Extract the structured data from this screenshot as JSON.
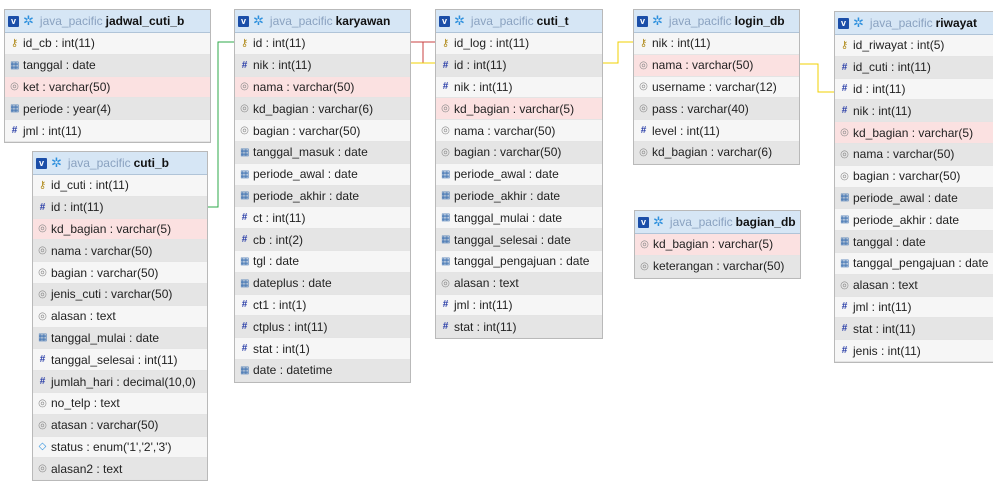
{
  "link_color": "#f0d000",
  "link_color_red": "#c94040",
  "link_color_green": "#2ea84a",
  "tables": [
    {
      "db": "java_pacific",
      "name": "jadwal_cuti_b",
      "cols": [
        {
          "t": "id_cb : int(11)",
          "k": "key"
        },
        {
          "t": "tanggal : date",
          "k": "date"
        },
        {
          "t": "ket : varchar(50)",
          "k": "str",
          "fk": true
        },
        {
          "t": "periode : year(4)",
          "k": "date"
        },
        {
          "t": "jml : int(11)",
          "k": "num"
        }
      ]
    },
    {
      "db": "java_pacific",
      "name": "cuti_b",
      "cols": [
        {
          "t": "id_cuti : int(11)",
          "k": "key"
        },
        {
          "t": "id : int(11)",
          "k": "num"
        },
        {
          "t": "kd_bagian : varchar(5)",
          "k": "str",
          "fk": true
        },
        {
          "t": "nama : varchar(50)",
          "k": "str"
        },
        {
          "t": "bagian : varchar(50)",
          "k": "str"
        },
        {
          "t": "jenis_cuti : varchar(50)",
          "k": "str"
        },
        {
          "t": "alasan : text",
          "k": "str"
        },
        {
          "t": "tanggal_mulai : date",
          "k": "date"
        },
        {
          "t": "tanggal_selesai : int(11)",
          "k": "num"
        },
        {
          "t": "jumlah_hari : decimal(10,0)",
          "k": "num"
        },
        {
          "t": "no_telp : text",
          "k": "str"
        },
        {
          "t": "atasan : varchar(50)",
          "k": "str"
        },
        {
          "t": "status : enum('1','2','3')",
          "k": "enum"
        },
        {
          "t": "alasan2 : text",
          "k": "str"
        }
      ]
    },
    {
      "db": "java_pacific",
      "name": "karyawan",
      "cols": [
        {
          "t": "id : int(11)",
          "k": "key"
        },
        {
          "t": "nik : int(11)",
          "k": "num"
        },
        {
          "t": "nama : varchar(50)",
          "k": "str",
          "fk": true
        },
        {
          "t": "kd_bagian : varchar(6)",
          "k": "str"
        },
        {
          "t": "bagian : varchar(50)",
          "k": "str"
        },
        {
          "t": "tanggal_masuk : date",
          "k": "date"
        },
        {
          "t": "periode_awal : date",
          "k": "date"
        },
        {
          "t": "periode_akhir : date",
          "k": "date"
        },
        {
          "t": "ct : int(11)",
          "k": "num"
        },
        {
          "t": "cb : int(2)",
          "k": "num"
        },
        {
          "t": "tgl : date",
          "k": "date"
        },
        {
          "t": "dateplus : date",
          "k": "date"
        },
        {
          "t": "ct1 : int(1)",
          "k": "num"
        },
        {
          "t": "ctplus : int(11)",
          "k": "num"
        },
        {
          "t": "stat : int(1)",
          "k": "num"
        },
        {
          "t": "date : datetime",
          "k": "date"
        }
      ]
    },
    {
      "db": "java_pacific",
      "name": "cuti_t",
      "cols": [
        {
          "t": "id_log : int(11)",
          "k": "key"
        },
        {
          "t": "id : int(11)",
          "k": "num"
        },
        {
          "t": "nik : int(11)",
          "k": "num"
        },
        {
          "t": "kd_bagian : varchar(5)",
          "k": "str",
          "fk": true
        },
        {
          "t": "nama : varchar(50)",
          "k": "str"
        },
        {
          "t": "bagian : varchar(50)",
          "k": "str"
        },
        {
          "t": "periode_awal : date",
          "k": "date"
        },
        {
          "t": "periode_akhir : date",
          "k": "date"
        },
        {
          "t": "tanggal_mulai : date",
          "k": "date"
        },
        {
          "t": "tanggal_selesai : date",
          "k": "date"
        },
        {
          "t": "tanggal_pengajuan : date",
          "k": "date"
        },
        {
          "t": "alasan : text",
          "k": "str"
        },
        {
          "t": "jml : int(11)",
          "k": "num"
        },
        {
          "t": "stat : int(11)",
          "k": "num"
        }
      ]
    },
    {
      "db": "java_pacific",
      "name": "login_db",
      "cols": [
        {
          "t": "nik : int(11)",
          "k": "key"
        },
        {
          "t": "nama : varchar(50)",
          "k": "str",
          "fk": true
        },
        {
          "t": "username : varchar(12)",
          "k": "str"
        },
        {
          "t": "pass : varchar(40)",
          "k": "str"
        },
        {
          "t": "level : int(11)",
          "k": "num"
        },
        {
          "t": "kd_bagian : varchar(6)",
          "k": "str"
        }
      ]
    },
    {
      "db": "java_pacific",
      "name": "bagian_db",
      "cols": [
        {
          "t": "kd_bagian : varchar(5)",
          "k": "str",
          "fk": true
        },
        {
          "t": "keterangan : varchar(50)",
          "k": "str"
        }
      ]
    },
    {
      "db": "java_pacific",
      "name": "riwayat",
      "cols": [
        {
          "t": "id_riwayat : int(5)",
          "k": "key"
        },
        {
          "t": "id_cuti : int(11)",
          "k": "num"
        },
        {
          "t": "id : int(11)",
          "k": "num"
        },
        {
          "t": "nik : int(11)",
          "k": "num"
        },
        {
          "t": "kd_bagian : varchar(5)",
          "k": "str",
          "fk": true
        },
        {
          "t": "nama : varchar(50)",
          "k": "str"
        },
        {
          "t": "bagian : varchar(50)",
          "k": "str"
        },
        {
          "t": "periode_awal : date",
          "k": "date"
        },
        {
          "t": "periode_akhir : date",
          "k": "date"
        },
        {
          "t": "tanggal : date",
          "k": "date"
        },
        {
          "t": "tanggal_pengajuan : date",
          "k": "date"
        },
        {
          "t": "alasan : text",
          "k": "str"
        },
        {
          "t": "jml : int(11)",
          "k": "num"
        },
        {
          "t": "stat : int(11)",
          "k": "num"
        },
        {
          "t": "jenis : int(11)",
          "k": "num"
        }
      ]
    }
  ]
}
